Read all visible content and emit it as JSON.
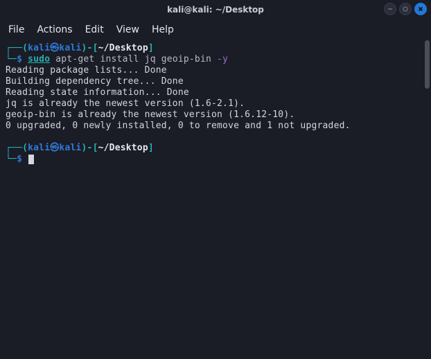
{
  "window": {
    "title": "kali@kali: ~/Desktop"
  },
  "menu": {
    "file": "File",
    "actions": "Actions",
    "edit": "Edit",
    "view": "View",
    "help": "Help"
  },
  "prompt1": {
    "corner_top": "┌──(",
    "user": "kali",
    "sep_icon": "㉿",
    "host": "kali",
    "close_paren": ")-[",
    "path": "~/Desktop",
    "close_bracket": "]",
    "corner_bot": "└─",
    "dollar": "$",
    "cmd_sudo": "sudo",
    "cmd_rest": " apt-get install jq geoip-bin ",
    "cmd_flag": "-y"
  },
  "output": {
    "l1": "Reading package lists... Done",
    "l2": "Building dependency tree... Done",
    "l3": "Reading state information... Done",
    "l4": "jq is already the newest version (1.6-2.1).",
    "l5": "geoip-bin is already the newest version (1.6.12-10).",
    "l6": "0 upgraded, 0 newly installed, 0 to remove and 1 not upgraded."
  },
  "prompt2": {
    "corner_top": "┌──(",
    "user": "kali",
    "sep_icon": "㉿",
    "host": "kali",
    "close_paren": ")-[",
    "path": "~/Desktop",
    "close_bracket": "]",
    "corner_bot": "└─",
    "dollar": "$"
  }
}
